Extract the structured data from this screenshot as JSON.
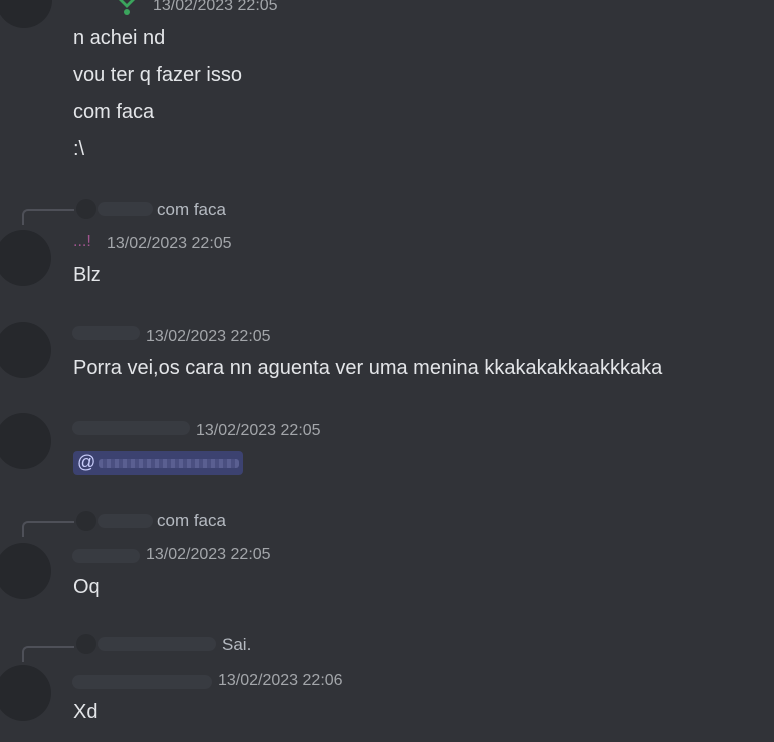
{
  "messages": {
    "m1": {
      "timestamp": "13/02/2023 22:05",
      "lines": [
        "n achei nd",
        "vou ter q fazer isso",
        "com faca",
        ":\\"
      ]
    },
    "m2": {
      "reply_text": "com faca",
      "prefix": "...!",
      "timestamp": "13/02/2023 22:05",
      "text": "Blz"
    },
    "m3": {
      "timestamp": "13/02/2023 22:05",
      "text": "Porra vei,os cara nn aguenta ver uma menina kkakakakkaakkkaka"
    },
    "m4": {
      "timestamp": "13/02/2023 22:05",
      "mention_symbol": "@"
    },
    "m5": {
      "reply_text": "com faca",
      "timestamp": "13/02/2023 22:05",
      "text": "Oq"
    },
    "m6": {
      "reply_text": "Sai.",
      "timestamp": "13/02/2023 22:06",
      "text": "Xd"
    }
  },
  "colors": {
    "background": "#313338",
    "text": "#e3e5e8",
    "timestamp": "#a3a6aa",
    "mention_bg": "#3c4270",
    "role_icon": "#3ba55d"
  },
  "icons": [
    "role-leaf-icon"
  ]
}
